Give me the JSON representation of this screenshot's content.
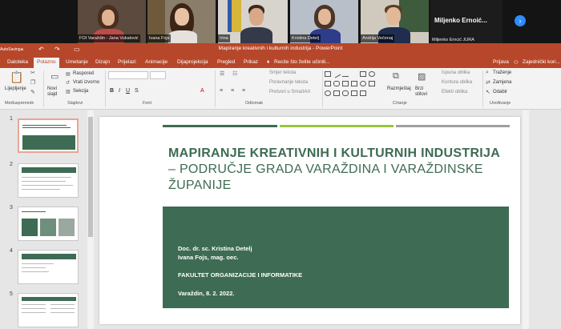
{
  "video_strip": {
    "participants": [
      {
        "label": "FOI Varaždin - Jana Vukalović"
      },
      {
        "label": "Ivana Fojs"
      },
      {
        "label": "Irina"
      },
      {
        "label": "Kristina Detelj"
      },
      {
        "label": "Andrija Večenaj"
      },
      {
        "label": "Miljenko Erncić JURA"
      }
    ],
    "name_tile_big": "Miljenko  Ernoić...",
    "next_icon": "chevron-right-icon"
  },
  "ppt": {
    "window_title": "Mapiranje kreativnih i kulturnih industrija - PowerPoint",
    "autosave": "AutoSaving...",
    "menu": {
      "tabs": [
        "Datoteka",
        "Polazno",
        "Umetanje",
        "Dizajn",
        "Prijelazi",
        "Animacije",
        "Dijaprojekcija",
        "Pregled",
        "Prikaz"
      ],
      "active_tab": "Polazno",
      "tell_me": "Recite što želite učiniti...",
      "sign_in": "Prijava",
      "share": "Zajednički kori..."
    },
    "ribbon": {
      "paste": "Lijepljenje",
      "clipboard_group": "Međuspremnik",
      "new_slide": "Novi slajd",
      "layout": "Raspored",
      "reset": "Vrati izvorno",
      "section": "Sekcija",
      "slides_group": "Slajdovi",
      "font_group": "Font",
      "text_direction": "Smjer teksta",
      "align_text": "Poravnanje teksta",
      "smartart": "Pretvori u SmartArt",
      "paragraph_group": "Odlomak",
      "arrange": "Razmještaj",
      "quick_styles": "Brzi stilovi",
      "shape_fill": "Ispuna oblika",
      "shape_outline": "Kontura oblika",
      "shape_effects": "Efekti oblika",
      "drawing_group": "Crtanje",
      "find": "Traženje",
      "replace": "Zamjena",
      "select": "Odabir",
      "editing_group": "Uređivanje"
    },
    "thumbnails": [
      "1",
      "2",
      "3",
      "4",
      "5"
    ],
    "slide": {
      "title_bold": "MAPIRANJE KREATIVNIH I KULTURNIH INDUSTRIJA",
      "title_rest": " – PODRUČJE GRADA VARAŽDINA I VARAŽDINSKE ŽUPANIJE",
      "author1": "Doc. dr. sc. Kristina Detelj",
      "author2": "Ivana Fojs, mag. oec.",
      "faculty": "FAKULTET ORGANIZACIJE I INFORMATIKE",
      "place_date": "Varaždin, 8. 2. 2022.",
      "accent_color": "#3e6b53",
      "bar_colors": [
        "#3e6b53",
        "#9ac53d",
        "#a0a0a0"
      ]
    },
    "colors": {
      "brand": "#b7472a",
      "ribbon_bg": "#f3f3f3"
    }
  }
}
